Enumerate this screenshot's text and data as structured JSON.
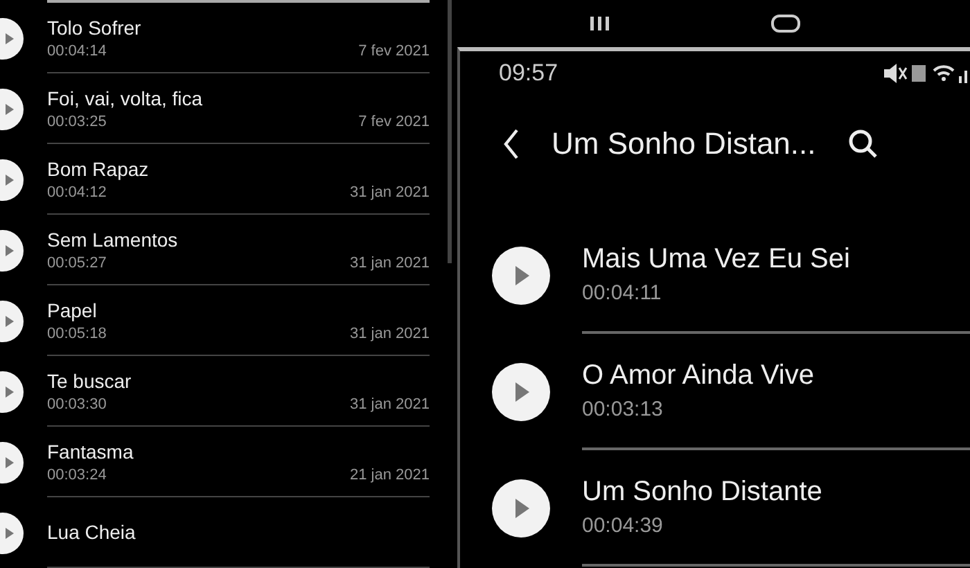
{
  "left_list": {
    "songs": [
      {
        "title": "Tolo Sofrer",
        "duration": "00:04:14",
        "date": "7 fev 2021"
      },
      {
        "title": "Foi, vai, volta, fica",
        "duration": "00:03:25",
        "date": "7 fev 2021"
      },
      {
        "title": "Bom Rapaz",
        "duration": "00:04:12",
        "date": "31 jan 2021"
      },
      {
        "title": "Sem Lamentos",
        "duration": "00:05:27",
        "date": "31 jan 2021"
      },
      {
        "title": "Papel",
        "duration": "00:05:18",
        "date": "31 jan 2021"
      },
      {
        "title": "Te buscar",
        "duration": "00:03:30",
        "date": "31 jan 2021"
      },
      {
        "title": "Fantasma",
        "duration": "00:03:24",
        "date": "21 jan 2021"
      },
      {
        "title": "Lua Cheia"
      }
    ]
  },
  "right_screen": {
    "status_bar": {
      "time": "09:57"
    },
    "header": {
      "title": "Um Sonho Distan..."
    },
    "songs": [
      {
        "title": "Mais Uma Vez Eu Sei",
        "duration": "00:04:11"
      },
      {
        "title": "O Amor Ainda Vive",
        "duration": "00:03:13"
      },
      {
        "title": "Um Sonho Distante",
        "duration": "00:04:39"
      }
    ]
  }
}
